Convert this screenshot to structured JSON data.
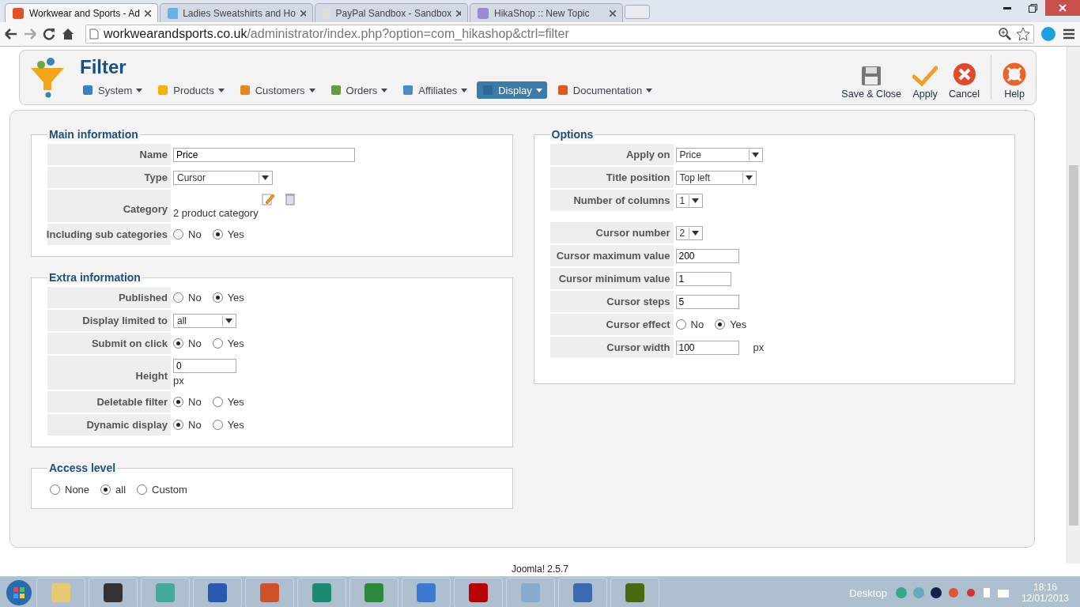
{
  "browser": {
    "tabs": [
      {
        "title": "Workwear and Sports - Ad",
        "selected": true
      },
      {
        "title": "Ladies Sweatshirts and Ho",
        "selected": false
      },
      {
        "title": "PayPal Sandbox - Sandbox",
        "selected": false
      },
      {
        "title": "HikaShop :: New Topic",
        "selected": false
      }
    ],
    "url": {
      "host": "workwearandsports.co.uk",
      "path": "/administrator/index.php?option=com_hikashop&ctrl=filter"
    }
  },
  "header": {
    "title": "Filter",
    "menu": [
      {
        "label": "System",
        "selected": false
      },
      {
        "label": "Products",
        "selected": false
      },
      {
        "label": "Customers",
        "selected": false
      },
      {
        "label": "Orders",
        "selected": false
      },
      {
        "label": "Affiliates",
        "selected": false
      },
      {
        "label": "Display",
        "selected": true
      },
      {
        "label": "Documentation",
        "selected": false
      }
    ],
    "actions": [
      {
        "label": "Save & Close",
        "kind": "save"
      },
      {
        "label": "Apply",
        "kind": "apply"
      },
      {
        "label": "Cancel",
        "kind": "cancel"
      },
      {
        "label": "Help",
        "kind": "help"
      }
    ]
  },
  "main_information": {
    "title": "Main information",
    "rows": [
      {
        "label": "Name",
        "kind": "text",
        "value": "Price"
      },
      {
        "label": "Type",
        "kind": "select",
        "value": "Cursor"
      },
      {
        "label": "Category",
        "kind": "category",
        "value": "2 product category"
      },
      {
        "label": "Including sub categories",
        "kind": "radio",
        "options": [
          {
            "label": "No",
            "selected": false
          },
          {
            "label": "Yes",
            "selected": true
          }
        ]
      }
    ]
  },
  "extra_information": {
    "title": "Extra information",
    "rows": [
      {
        "label": "Published",
        "kind": "radio",
        "options": [
          {
            "label": "No",
            "selected": false
          },
          {
            "label": "Yes",
            "selected": true
          }
        ]
      },
      {
        "label": "Display limited to",
        "kind": "select",
        "value": "all"
      },
      {
        "label": "Submit on click",
        "kind": "radio",
        "options": [
          {
            "label": "No",
            "selected": true
          },
          {
            "label": "Yes",
            "selected": false
          }
        ]
      },
      {
        "label": "Height",
        "kind": "text_stacked",
        "value": "0",
        "unit": "px"
      },
      {
        "label": "Deletable filter",
        "kind": "radio",
        "options": [
          {
            "label": "No",
            "selected": true
          },
          {
            "label": "Yes",
            "selected": false
          }
        ]
      },
      {
        "label": "Dynamic display",
        "kind": "radio",
        "options": [
          {
            "label": "No",
            "selected": true
          },
          {
            "label": "Yes",
            "selected": false
          }
        ]
      }
    ]
  },
  "access_level": {
    "title": "Access level",
    "options": [
      {
        "label": "None",
        "selected": false
      },
      {
        "label": "all",
        "selected": true
      },
      {
        "label": "Custom",
        "selected": false
      }
    ]
  },
  "options": {
    "title": "Options",
    "groups": [
      [
        {
          "label": "Apply on",
          "kind": "select",
          "value": "Price"
        },
        {
          "label": "Title position",
          "kind": "select",
          "value": "Top left"
        },
        {
          "label": "Number of columns",
          "kind": "select",
          "value": "1"
        }
      ],
      [
        {
          "label": "Cursor number",
          "kind": "select",
          "value": "2"
        },
        {
          "label": "Cursor maximum value",
          "kind": "text",
          "value": "200"
        },
        {
          "label": "Cursor minimum value",
          "kind": "text",
          "value": "1"
        },
        {
          "label": "Cursor steps",
          "kind": "text",
          "value": "5"
        },
        {
          "label": "Cursor effect",
          "kind": "radio",
          "options": [
            {
              "label": "No",
              "selected": false
            },
            {
              "label": "Yes",
              "selected": true
            }
          ]
        },
        {
          "label": "Cursor width",
          "kind": "text",
          "value": "100",
          "unit": "px"
        }
      ]
    ]
  },
  "footer": "Joomla! 2.5.7",
  "taskbar": {
    "desktop": "Desktop",
    "time": "18:16",
    "date": "12/01/2013"
  }
}
